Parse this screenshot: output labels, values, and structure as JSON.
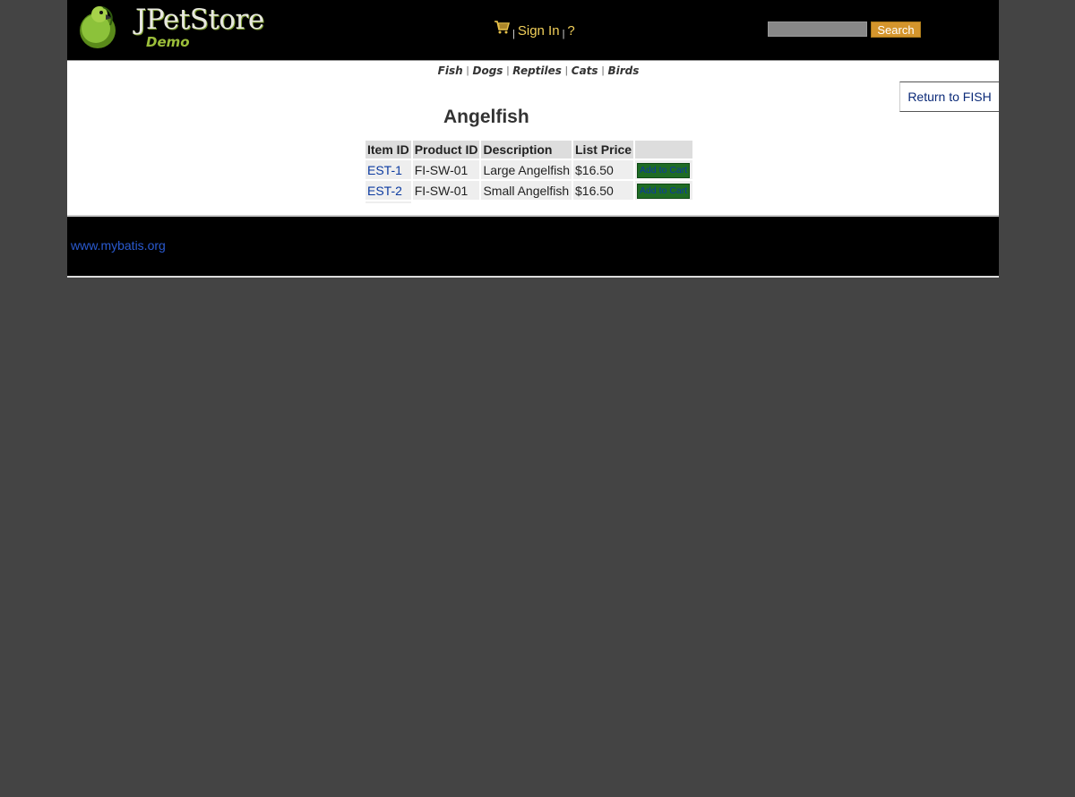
{
  "header": {
    "brand": "JPetStore",
    "brand_sub": "Demo",
    "menu": {
      "cart_icon": "cart-icon",
      "separator": "|",
      "sign_in": "Sign In",
      "help": "?"
    },
    "search": {
      "value": "",
      "button_label": "Search"
    },
    "colors": {
      "header_bg": "#000000",
      "menu_link": "#f2d05a",
      "search_button": "#d4952c"
    }
  },
  "quick_links": [
    "Fish",
    "Dogs",
    "Reptiles",
    "Cats",
    "Birds"
  ],
  "quick_link_separator": "|",
  "back_link": "Return to FISH",
  "product": {
    "title": "Angelfish",
    "columns": [
      "Item ID",
      "Product ID",
      "Description",
      "List Price",
      ""
    ],
    "rows": [
      {
        "item_id": "EST-1",
        "product_id": "FI-SW-01",
        "description": "Large Angelfish",
        "price": "$16.50",
        "action": "Add to Cart"
      },
      {
        "item_id": "EST-2",
        "product_id": "FI-SW-01",
        "description": "Small Angelfish",
        "price": "$16.50",
        "action": "Add to Cart"
      }
    ]
  },
  "footer": {
    "link": "www.mybatis.org"
  }
}
